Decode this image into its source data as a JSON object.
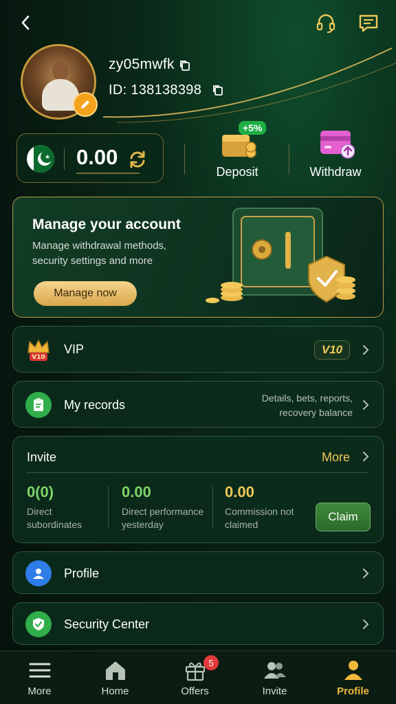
{
  "header": {
    "back_icon": "chevron-left-icon",
    "support_icon": "headset-icon",
    "message_icon": "message-icon"
  },
  "profile": {
    "username": "zy05mwfk",
    "id_text": "ID: 138138398",
    "edit_icon": "pencil-icon",
    "copy_icon": "copy-icon"
  },
  "balance": {
    "currency_flag": "pakistan-flag-icon",
    "amount": "0.00",
    "refresh_icon": "refresh-icon"
  },
  "actions": {
    "deposit_label": "Deposit",
    "deposit_bonus": "+5%",
    "withdraw_label": "Withdraw"
  },
  "manage": {
    "title": "Manage your account",
    "description": "Manage withdrawal methods, security settings and more",
    "button": "Manage now"
  },
  "vip": {
    "label": "VIP",
    "level": "V10",
    "crown_text": "V10"
  },
  "records": {
    "label": "My records",
    "note_line1": "Details, bets, reports,",
    "note_line2": "recovery balance"
  },
  "invite": {
    "title": "Invite",
    "more": "More",
    "stats": [
      {
        "value": "0(0)",
        "cap1": "Direct",
        "cap2": "subordinates"
      },
      {
        "value": "0.00",
        "cap1": "Direct performance",
        "cap2": "yesterday"
      },
      {
        "value": "0.00",
        "cap1": "Commission not",
        "cap2": "claimed"
      }
    ],
    "claim": "Claim"
  },
  "menu": {
    "profile": "Profile",
    "security": "Security Center"
  },
  "nav": {
    "items": [
      {
        "label": "More",
        "icon": "menu-icon"
      },
      {
        "label": "Home",
        "icon": "home-icon"
      },
      {
        "label": "Offers",
        "icon": "gift-icon",
        "badge": "5"
      },
      {
        "label": "Invite",
        "icon": "users-icon"
      },
      {
        "label": "Profile",
        "icon": "person-icon"
      }
    ],
    "active": "Profile"
  },
  "colors": {
    "accent_gold": "#f0c85a",
    "background": "#07170f",
    "card": "#0c2d1c",
    "active_nav": "#f0b93a"
  }
}
